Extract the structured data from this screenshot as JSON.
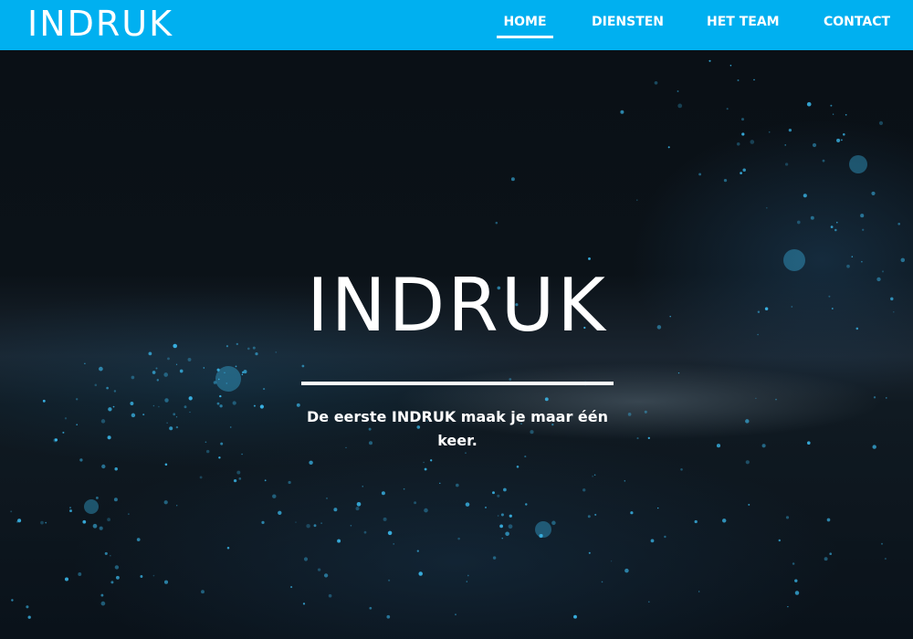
{
  "colors": {
    "header_bg": "#00b0f0",
    "text": "#ffffff",
    "hero_bg": "#0a1016",
    "city_lights": "#3fc8ff"
  },
  "header": {
    "logo_text": "INDRUK",
    "nav": [
      {
        "label": "HOME",
        "active": true
      },
      {
        "label": "DIENSTEN",
        "active": false
      },
      {
        "label": "HET TEAM",
        "active": false
      },
      {
        "label": "CONTACT",
        "active": false
      }
    ]
  },
  "hero": {
    "title": "INDRUK",
    "tagline": "De eerste INDRUK maak je maar één keer.",
    "background": "earth-at-night-image"
  }
}
